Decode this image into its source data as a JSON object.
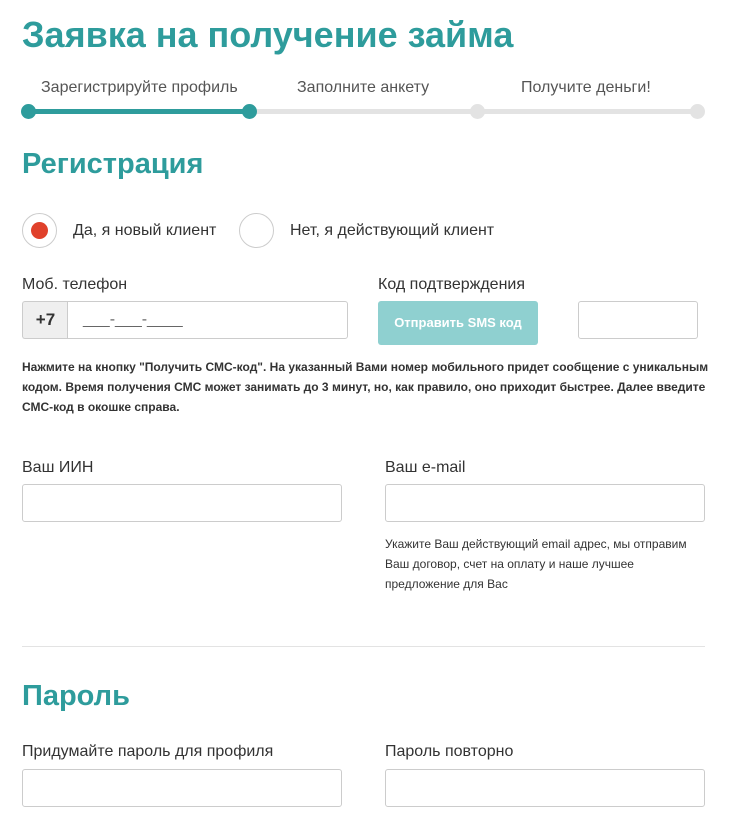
{
  "page_title": "Заявка на получение займа",
  "progress": {
    "steps": [
      {
        "label": "Зарегистрируйте профиль",
        "state": "done"
      },
      {
        "label": "Заполните анкету",
        "state": "upcoming"
      },
      {
        "label": "Получите деньги!",
        "state": "upcoming"
      }
    ],
    "completed_fraction": 0.33
  },
  "registration": {
    "title": "Регистрация",
    "client_type": {
      "options": [
        {
          "label": "Да, я новый клиент",
          "selected": true
        },
        {
          "label": "Нет, я действующий клиент",
          "selected": false
        }
      ]
    },
    "phone": {
      "label": "Моб. телефон",
      "prefix": "+7",
      "placeholder": "___-___-____",
      "value": ""
    },
    "confirmation": {
      "label": "Код подтверждения",
      "send_button": "Отправить SMS код",
      "code_value": ""
    },
    "sms_hint": "Нажмите на кнопку \"Получить СМС-код\". На указанный Вами номер мобильного придет сообщение с уникальным кодом. Время получения СМС может занимать до 3 минут, но, как правило, оно приходит быстрее. Далее введите СМС-код в окошке справа.",
    "iin": {
      "label": "Ваш ИИН",
      "value": ""
    },
    "email": {
      "label": "Ваш e-mail",
      "value": "",
      "hint": "Укажите Ваш действующий email адрес, мы отправим Ваш договор, счет на оплату и наше лучшее предложение для Вас"
    }
  },
  "password": {
    "title": "Пароль",
    "create_label": "Придумайте пароль для профиля",
    "repeat_label": "Пароль повторно"
  },
  "colors": {
    "accent": "#2e9c9c",
    "accent_light": "#8fd0d0",
    "radio_selected": "#e0412b",
    "track": "#e3e3e3"
  }
}
